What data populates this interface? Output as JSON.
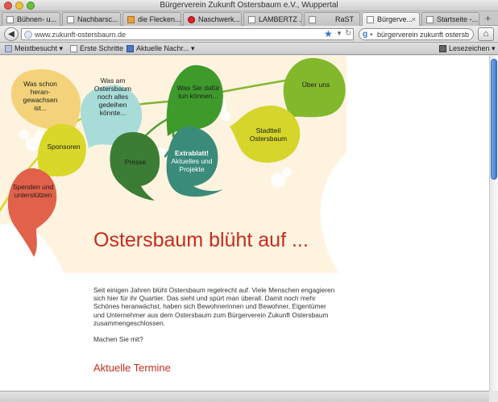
{
  "window": {
    "title": "Bürgerverein Zukunft Ostersbaum e.V., Wuppertal"
  },
  "tabs": [
    {
      "label": "Bühnen- u...",
      "favicon": "page-icon",
      "active": false
    },
    {
      "label": "Nachbarsc...",
      "favicon": "page-icon",
      "active": false
    },
    {
      "label": "die Flecken...",
      "favicon": "orange-icon",
      "active": false
    },
    {
      "label": "Naschwerk...",
      "favicon": "red-icon",
      "active": false
    },
    {
      "label": "LAMBERTZ ...",
      "favicon": "page-icon",
      "active": false
    },
    {
      "label": "RaST",
      "favicon": "page-icon",
      "active": false
    },
    {
      "label": "Bürgerve...",
      "favicon": "page-icon",
      "active": true
    },
    {
      "label": "Startseite -...",
      "favicon": "page-icon",
      "active": false
    }
  ],
  "toolbar": {
    "url": "www.zukunft-ostersbaum.de",
    "search_query": "bürgerverein zukunft ostersb"
  },
  "bookmarks": {
    "most_visited": "Meistbesucht",
    "first_steps": "Erste Schritte",
    "news": "Aktuelle Nachr...",
    "bookmarks_menu": "Lesezeichen"
  },
  "leaves": [
    {
      "lines": [
        "Was schon",
        "heran-",
        "gewachsen",
        "ist..."
      ],
      "color": "#f3d27a"
    },
    {
      "lines": [
        "Was am",
        "Ostersbaum",
        "noch alles",
        "gedeihen",
        "könnte..."
      ],
      "color": "#a8dcd9"
    },
    {
      "lines": [
        "Was Sie dafür",
        "tun können..."
      ],
      "color": "#3f9a2c"
    },
    {
      "lines": [
        "Über uns"
      ],
      "color": "#83b82d"
    },
    {
      "lines": [
        "Stadtteil",
        "Ostersbaum"
      ],
      "color": "#d5d52b"
    },
    {
      "lines": [
        "Sponsoren"
      ],
      "color": "#d9d72a"
    },
    {
      "lines": [
        "Presse"
      ],
      "color": "#3b7d34"
    },
    {
      "lines": [
        "Extrablatt!",
        "Aktuelles und",
        "Projekte"
      ],
      "color": "#3a8b7a"
    },
    {
      "lines": [
        "Spenden und",
        "unterstützen"
      ],
      "color": "#e2614a"
    }
  ],
  "main": {
    "headline": "Ostersbaum blüht auf ...",
    "intro": "Seit einigen Jahren blüht Ostersbaum regelrecht auf. Viele Menschen engagieren sich hier für ihr Quartier. Das sieht und spürt man überall. Damit noch mehr Schönes heranwächst, haben sich Bewohnerinnen und Bewohner, Eigentümer und Unternehmer aus dem Ostersbaum zum Bürgerverein Zukunft Ostersbaum zusammengeschlossen.",
    "question": "Machen Sie mit?",
    "section_heading": "Aktuelle Termine"
  },
  "colors": {
    "accent": "#c42d20",
    "background_wash": "#fdf3df"
  }
}
